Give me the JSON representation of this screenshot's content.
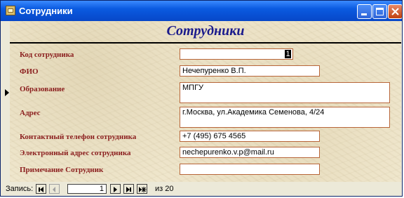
{
  "window": {
    "title": "Сотрудники"
  },
  "form": {
    "title": "Сотрудники",
    "fields": [
      {
        "label": "Код сотрудника",
        "value": "",
        "cursor": "1"
      },
      {
        "label": "ФИО",
        "value": "Нечепуренко В.П."
      },
      {
        "label": "Образование",
        "value": "МПГУ"
      },
      {
        "label": "Адрес",
        "value": "г.Москва, ул.Академика Семенова, 4/24"
      },
      {
        "label": "Контактный телефон сотрудника",
        "value": "+7 (495) 675 4565"
      },
      {
        "label": "Электронный адрес сотрудника",
        "value": "nechepurenko.v.p@mail.ru"
      },
      {
        "label": "Примечание Сотрудник",
        "value": ""
      }
    ]
  },
  "navigation": {
    "label": "Запись:",
    "current": "1",
    "of_text": "из  20"
  },
  "colors": {
    "title_bar": "#0a5ae0",
    "form_title": "#1a1a8c",
    "label": "#8b1e1e",
    "field_border": "#b8663a"
  }
}
